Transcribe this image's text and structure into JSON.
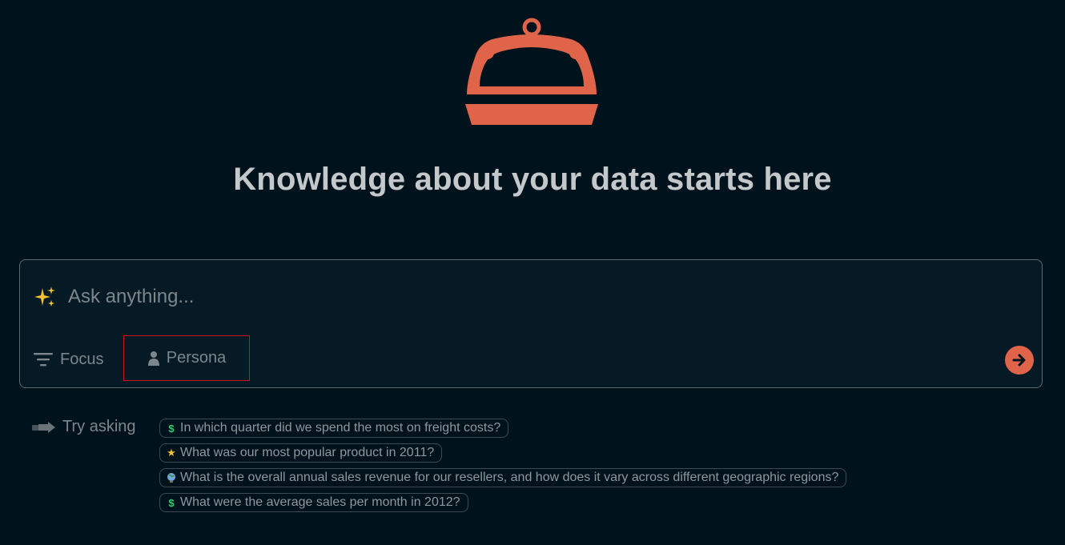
{
  "hero": {
    "headline": "Knowledge about your data starts here"
  },
  "ask": {
    "placeholder": "Ask anything...",
    "value": "",
    "focus_label": "Focus",
    "persona_label": "Persona"
  },
  "try_asking": {
    "label": "Try asking",
    "suggestions": [
      {
        "icon": "dollar-icon",
        "text": "In which quarter did we spend the most on freight costs?"
      },
      {
        "icon": "star-icon",
        "text": "What was our most popular product in 2011?"
      },
      {
        "icon": "globe-icon",
        "text": "What is the overall annual sales revenue for our resellers, and how does it vary across different geographic regions?"
      },
      {
        "icon": "dollar-icon",
        "text": "What were the average sales per month in 2012?"
      }
    ]
  },
  "colors": {
    "background": "#00121c",
    "accent": "#e0644a",
    "highlight_border": "#d0121a"
  }
}
